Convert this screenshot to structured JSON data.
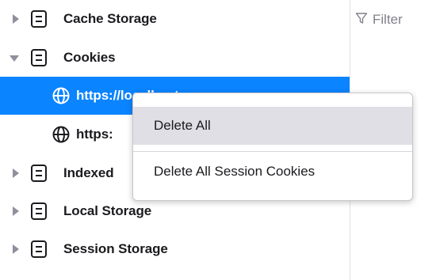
{
  "tree": {
    "items": [
      {
        "label": "Cache Storage",
        "expanded": false,
        "icon": "storage-icon"
      },
      {
        "label": "Cookies",
        "expanded": true,
        "icon": "storage-icon",
        "children": [
          {
            "label": "https://localhost",
            "icon": "globe-icon",
            "selected": true
          },
          {
            "label": "https:",
            "icon": "globe-icon",
            "selected": false
          }
        ]
      },
      {
        "label": "Indexed",
        "expanded": false,
        "icon": "storage-icon"
      },
      {
        "label": "Local Storage",
        "expanded": false,
        "icon": "storage-icon"
      },
      {
        "label": "Session Storage",
        "expanded": false,
        "icon": "storage-icon"
      }
    ]
  },
  "filter": {
    "icon": "filter-icon",
    "placeholder": "Filter"
  },
  "context_menu": {
    "items": [
      {
        "label": "Delete All",
        "hovered": true
      },
      {
        "label": "Delete All Session Cookies",
        "hovered": false
      }
    ]
  },
  "colors": {
    "selection": "#0a84ff",
    "menu_hover": "#e0dfe5",
    "divider": "#e3e3e6"
  }
}
